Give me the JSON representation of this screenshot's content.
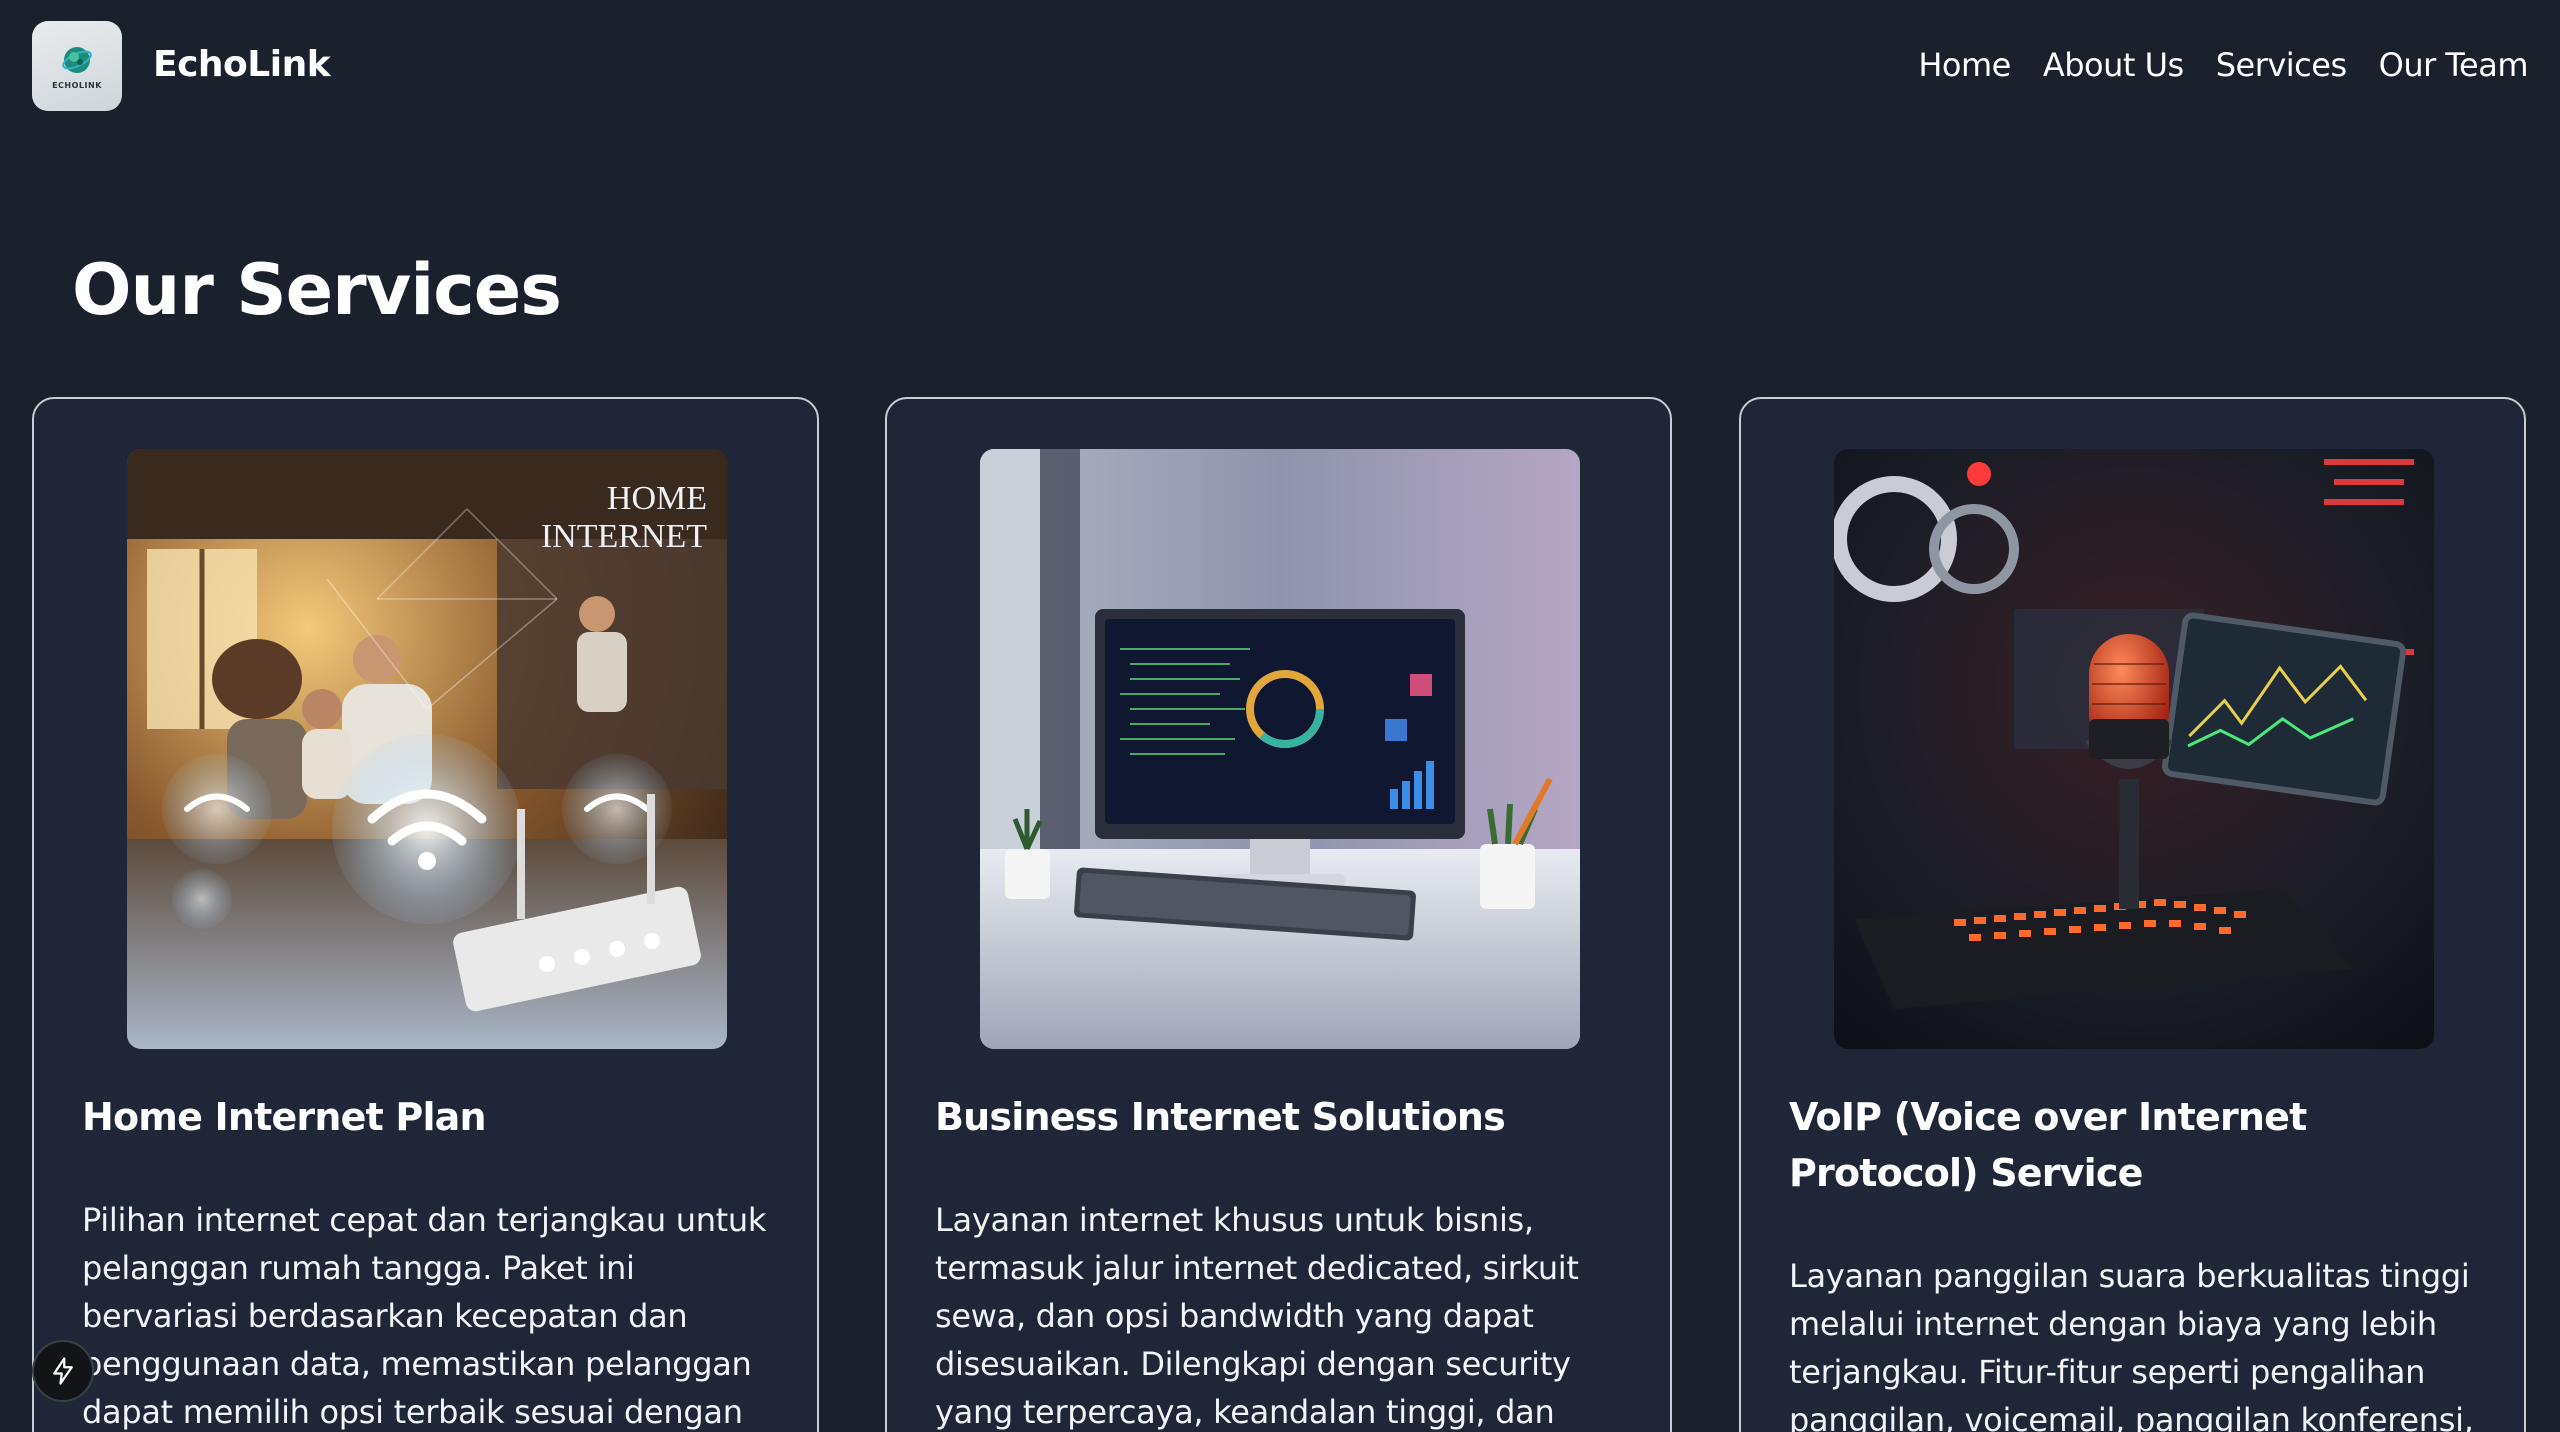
{
  "header": {
    "logo_text": "ECHOLINK",
    "brand": "EchoLink",
    "nav": [
      "Home",
      "About Us",
      "Services",
      "Our Team"
    ]
  },
  "section": {
    "title": "Our Services"
  },
  "cards": [
    {
      "image_icon": "home-internet-image",
      "image_text_1": "HOME",
      "image_text_2": "INTERNET",
      "title": "Home Internet Plan",
      "description": "Pilihan internet cepat dan terjangkau untuk pelanggan rumah tangga. Paket ini bervariasi berdasarkan kecepatan dan penggunaan data, memastikan pelanggan dapat memilih opsi terbaik sesuai dengan kebutuhan rumah,"
    },
    {
      "image_icon": "business-internet-image",
      "title": "Business Internet Solutions",
      "description": "Layanan internet khusus untuk bisnis, termasuk jalur internet dedicated, sirkuit sewa, dan opsi bandwidth yang dapat disesuaikan. Dilengkapi dengan security yang terpercaya, keandalan tinggi, dan dukungan"
    },
    {
      "image_icon": "voip-microphone-image",
      "title": "VoIP (Voice over Internet Protocol) Service",
      "description": "Layanan panggilan suara berkualitas tinggi melalui internet dengan biaya yang lebih terjangkau. Fitur-fitur seperti pengalihan panggilan, voicemail, panggilan konferensi,"
    }
  ],
  "floating_button": {
    "icon": "lightning-bolt-icon"
  },
  "colors": {
    "background": "#1a202c",
    "card_background": "#1e2637",
    "card_border": "#c9ccd1",
    "text": "#ffffff"
  }
}
